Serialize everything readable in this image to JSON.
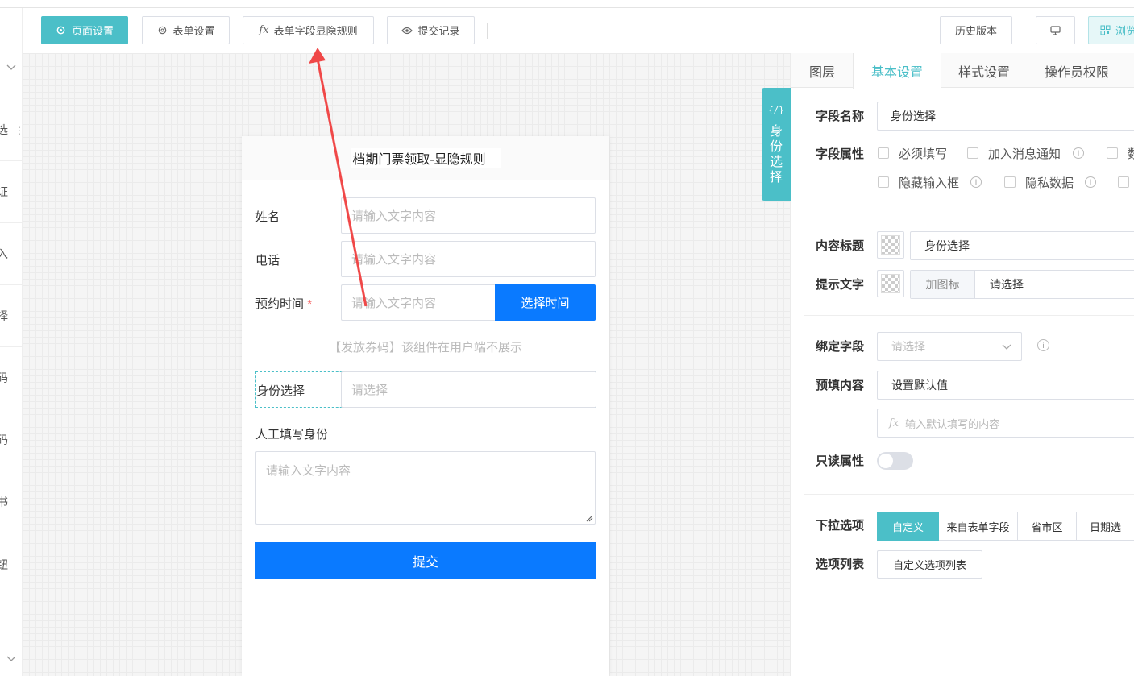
{
  "toolbar": {
    "page_settings": "页面设置",
    "form_settings": "表单设置",
    "field_rules_fx": "fx",
    "field_rules": "表单字段显隐规则",
    "submit_records": "提交记录",
    "history": "历史版本",
    "browse": "浏览"
  },
  "leftnav": {
    "items": [
      "选",
      "证",
      "入",
      "择",
      "码",
      "码",
      "书",
      "钮"
    ]
  },
  "form": {
    "title": "档期门票领取-显隐规则",
    "name_label": "姓名",
    "name_placeholder": "请输入文字内容",
    "phone_label": "电话",
    "phone_placeholder": "请输入文字内容",
    "appointment_label": "预约时间",
    "required_mark": "*",
    "appointment_placeholder": "请输入文字内容",
    "choose_time": "选择时间",
    "coupon_notice": "【发放券码】该组件在用户端不展示",
    "identity_label": "身份选择",
    "identity_placeholder": "请选择",
    "manual_identity_label": "人工填写身份",
    "manual_identity_placeholder": "请输入文字内容",
    "submit": "提交"
  },
  "sidetab": {
    "icon": "{/}",
    "chars": [
      "身",
      "份",
      "选",
      "择"
    ]
  },
  "panel": {
    "tabs": [
      "图层",
      "基本设置",
      "样式设置",
      "操作员权限"
    ],
    "active_tab": "基本设置",
    "field_name_label": "字段名称",
    "field_name_value": "身份选择",
    "field_attr_label": "字段属性",
    "attr_required": "必须填写",
    "attr_notify": "加入消息通知",
    "attr_truncated": "数",
    "attr_hidden": "隐藏输入框",
    "attr_private": "隐私数据",
    "content_title_label": "内容标题",
    "content_title_value": "身份选择",
    "hint_label": "提示文字",
    "add_icon": "加图标",
    "hint_value": "请选择",
    "bind_label": "绑定字段",
    "bind_placeholder": "请选择",
    "prefill_label": "预填内容",
    "prefill_value": "设置默认值",
    "prefill_fx": "fx",
    "prefill_placeholder": "输入默认填写的内容",
    "readonly_label": "只读属性",
    "readonly_on": false,
    "dropdown_label": "下拉选项",
    "dropdown_options": [
      "自定义",
      "来自表单字段",
      "省市区",
      "日期选"
    ],
    "dropdown_active": "自定义",
    "options_list_label": "选项列表",
    "options_list_button": "自定义选项列表"
  },
  "colors": {
    "accent": "#4bbfc8",
    "primary_blue": "#0a7aff",
    "annotation_arrow": "#f04848",
    "required_red": "#f56c6c"
  }
}
